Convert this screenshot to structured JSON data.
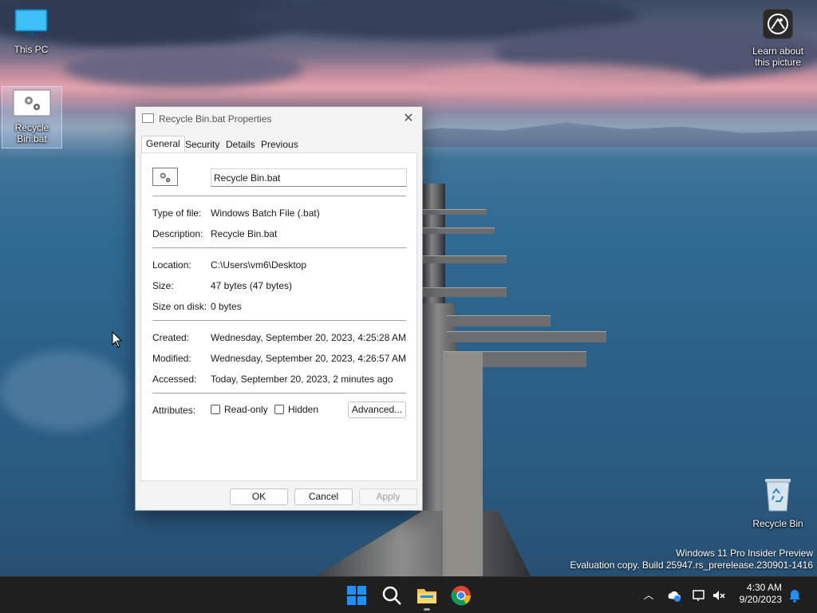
{
  "desktop": {
    "icons": [
      {
        "label": "This PC"
      },
      {
        "label": "Recycle Bin.bat"
      },
      {
        "label": "Learn about this picture"
      },
      {
        "label": "Recycle Bin"
      }
    ]
  },
  "dialog": {
    "title": "Recycle Bin.bat Properties",
    "tabs": [
      {
        "label": "General"
      },
      {
        "label": "Security"
      },
      {
        "label": "Details"
      },
      {
        "label": "Previous Versions"
      }
    ],
    "file_name": "Recycle Bin.bat",
    "fields": {
      "type_label": "Type of file:",
      "type_value": "Windows Batch File (.bat)",
      "desc_label": "Description:",
      "desc_value": "Recycle Bin.bat",
      "location_label": "Location:",
      "location_value": "C:\\Users\\vm6\\Desktop",
      "size_label": "Size:",
      "size_value": "47 bytes (47 bytes)",
      "disk_label": "Size on disk:",
      "disk_value": "0 bytes",
      "created_label": "Created:",
      "created_value": "Wednesday, September 20, 2023, 4:25:28 AM",
      "modified_label": "Modified:",
      "modified_value": "Wednesday, September 20, 2023, 4:26:57 AM",
      "accessed_label": "Accessed:",
      "accessed_value": "Today, September 20, 2023, 2 minutes ago",
      "attributes_label": "Attributes:"
    },
    "attributes": {
      "readonly_label": "Read-only",
      "hidden_label": "Hidden",
      "advanced_label": "Advanced..."
    },
    "buttons": {
      "ok": "OK",
      "cancel": "Cancel",
      "apply": "Apply"
    }
  },
  "watermark": {
    "line1": "Windows 11 Pro Insider Preview",
    "line2": "Evaluation copy. Build 25947.rs_prerelease.230901-1416"
  },
  "taskbar": {
    "time": "4:30 AM",
    "date": "9/20/2023"
  },
  "colors": {
    "taskbar_bg": "#1f1f1f",
    "dialog_bg": "#f3f3f3",
    "windows_blue": "#1e90ff"
  }
}
